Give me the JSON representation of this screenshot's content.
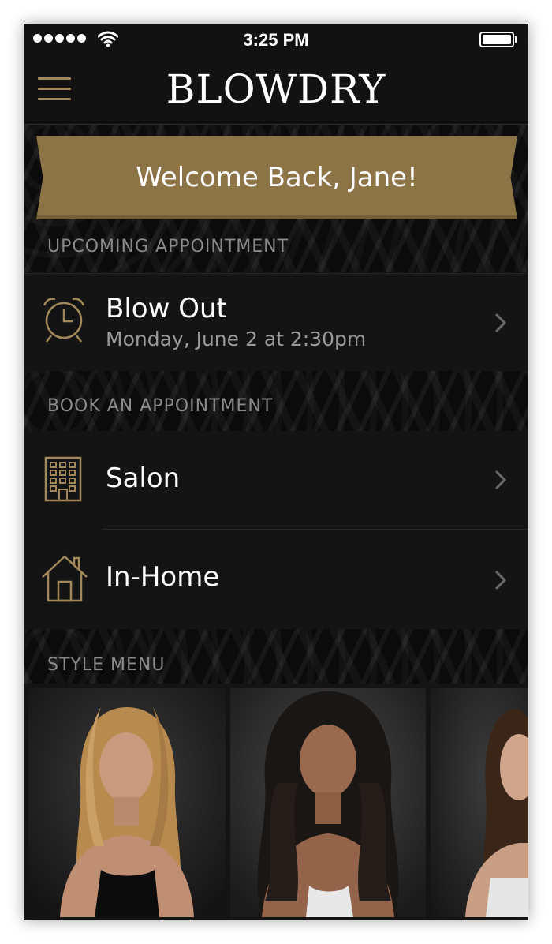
{
  "status_bar": {
    "time": "3:25 PM"
  },
  "navbar": {
    "brand": "BLOWDRY",
    "menu_icon": "hamburger-menu-icon"
  },
  "banner": {
    "text": "Welcome Back, Jane!"
  },
  "upcoming": {
    "header": "UPCOMING APPOINTMENT",
    "icon": "alarm-clock-icon",
    "title": "Blow Out",
    "subtitle": "Monday, June 2 at 2:30pm"
  },
  "book": {
    "header": "BOOK AN APPOINTMENT",
    "items": [
      {
        "label": "Salon",
        "icon": "building-icon"
      },
      {
        "label": "In-Home",
        "icon": "house-icon"
      }
    ]
  },
  "style_menu": {
    "header": "STYLE MENU",
    "cards": [
      {
        "hair_color": "#b88a4e"
      },
      {
        "hair_color": "#1a1614"
      },
      {
        "hair_color": "#3a2618"
      }
    ]
  },
  "colors": {
    "background": "#121212",
    "accent_gold": "#8d7446",
    "icon_gold": "#a2875a",
    "header_gray": "#8a8a8a"
  }
}
